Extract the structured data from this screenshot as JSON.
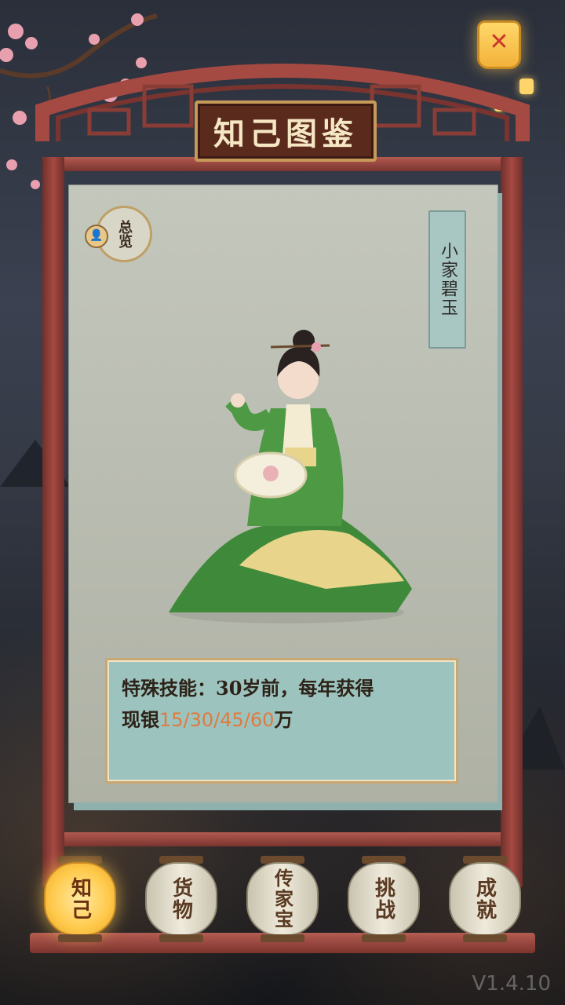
{
  "title": "知己图鉴",
  "overview_label": "总览",
  "character_name": "小家碧玉",
  "skill": {
    "prefix": "特殊技能：30岁前，每年获得",
    "line2_prefix": "现银",
    "values": "15/30/45/60",
    "suffix": "万"
  },
  "close_icon": "x-icon",
  "tabs": [
    {
      "label": "知己",
      "active": true
    },
    {
      "label": "货物",
      "active": false
    },
    {
      "label": "传家宝",
      "active": false
    },
    {
      "label": "挑战",
      "active": false
    },
    {
      "label": "成就",
      "active": false
    }
  ],
  "version": "V1.4.10",
  "colors": {
    "highlight": "#e07a3f",
    "active_tab": "#ffc94a",
    "frame": "#a54a42"
  }
}
